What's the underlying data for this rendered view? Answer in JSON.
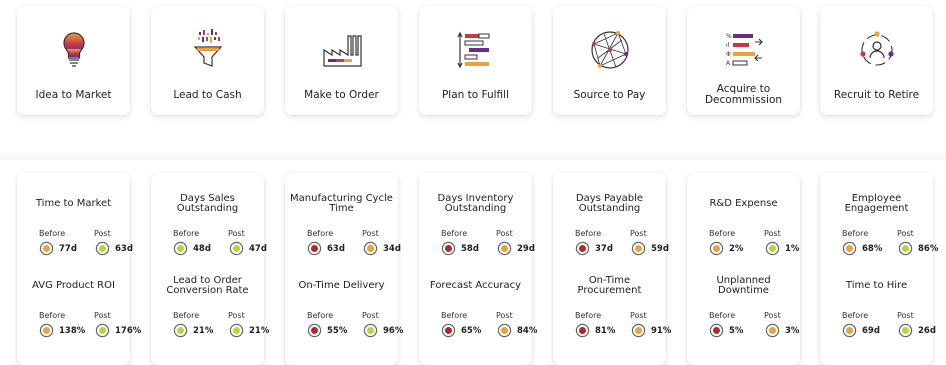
{
  "colors": {
    "red": "#b3282d",
    "orange": "#e8a33a",
    "green": "#b8d63a"
  },
  "processes": [
    {
      "label": "Idea to Market",
      "icon": "lightbulb-icon"
    },
    {
      "label": "Lead to Cash",
      "icon": "funnel-icon"
    },
    {
      "label": "Make to Order",
      "icon": "factory-icon"
    },
    {
      "label": "Plan to Fulfill",
      "icon": "planning-bars-icon"
    },
    {
      "label": "Source to Pay",
      "icon": "network-sphere-icon"
    },
    {
      "label": "Acquire to Decommission",
      "icon": "asset-list-icon"
    },
    {
      "label": "Recruit to Retire",
      "icon": "people-cycle-icon"
    }
  ],
  "kpi_columns": [
    {
      "metrics": [
        {
          "title": "Time to Market",
          "before_label": "Before",
          "post_label": "Post",
          "before_value": "77d",
          "post_value": "63d",
          "before_status": "orange",
          "post_status": "green"
        },
        {
          "title": "AVG Product ROI",
          "before_label": "Before",
          "post_label": "Post",
          "before_value": "138%",
          "post_value": "176%",
          "before_status": "orange",
          "post_status": "green"
        }
      ]
    },
    {
      "metrics": [
        {
          "title": "Days Sales Outstanding",
          "before_label": "Before",
          "post_label": "Post",
          "before_value": "48d",
          "post_value": "47d",
          "before_status": "green",
          "post_status": "green"
        },
        {
          "title": "Lead to Order Conversion Rate",
          "before_label": "Before",
          "post_label": "Post",
          "before_value": "21%",
          "post_value": "21%",
          "before_status": "green",
          "post_status": "green"
        }
      ]
    },
    {
      "metrics": [
        {
          "title": "Manufacturing Cycle Time",
          "before_label": "Before",
          "post_label": "Post",
          "before_value": "63d",
          "post_value": "34d",
          "before_status": "red",
          "post_status": "orange"
        },
        {
          "title": "On-Time Delivery",
          "before_label": "Before",
          "post_label": "Post",
          "before_value": "55%",
          "post_value": "96%",
          "before_status": "red",
          "post_status": "green"
        }
      ]
    },
    {
      "metrics": [
        {
          "title": "Days Inventory Outstanding",
          "before_label": "Before",
          "post_label": "Post",
          "before_value": "58d",
          "post_value": "29d",
          "before_status": "red",
          "post_status": "orange"
        },
        {
          "title": "Forecast Accuracy",
          "before_label": "Before",
          "post_label": "Post",
          "before_value": "65%",
          "post_value": "84%",
          "before_status": "red",
          "post_status": "orange"
        }
      ]
    },
    {
      "metrics": [
        {
          "title": "Days Payable Outstanding",
          "before_label": "Before",
          "post_label": "Post",
          "before_value": "37d",
          "post_value": "59d",
          "before_status": "red",
          "post_status": "orange"
        },
        {
          "title": "On-Time Procurement",
          "before_label": "Before",
          "post_label": "Post",
          "before_value": "81%",
          "post_value": "91%",
          "before_status": "red",
          "post_status": "orange"
        }
      ]
    },
    {
      "metrics": [
        {
          "title": "R&D Expense",
          "before_label": "Before",
          "post_label": "Post",
          "before_value": "2%",
          "post_value": "1%",
          "before_status": "orange",
          "post_status": "green"
        },
        {
          "title": "Unplanned Downtime",
          "before_label": "Before",
          "post_label": "Post",
          "before_value": "5%",
          "post_value": "3%",
          "before_status": "red",
          "post_status": "orange"
        }
      ]
    },
    {
      "metrics": [
        {
          "title": "Employee Engagement",
          "before_label": "Before",
          "post_label": "Post",
          "before_value": "68%",
          "post_value": "86%",
          "before_status": "orange",
          "post_status": "green"
        },
        {
          "title": "Time to Hire",
          "before_label": "Before",
          "post_label": "Post",
          "before_value": "69d",
          "post_value": "26d",
          "before_status": "orange",
          "post_status": "green"
        }
      ]
    }
  ]
}
